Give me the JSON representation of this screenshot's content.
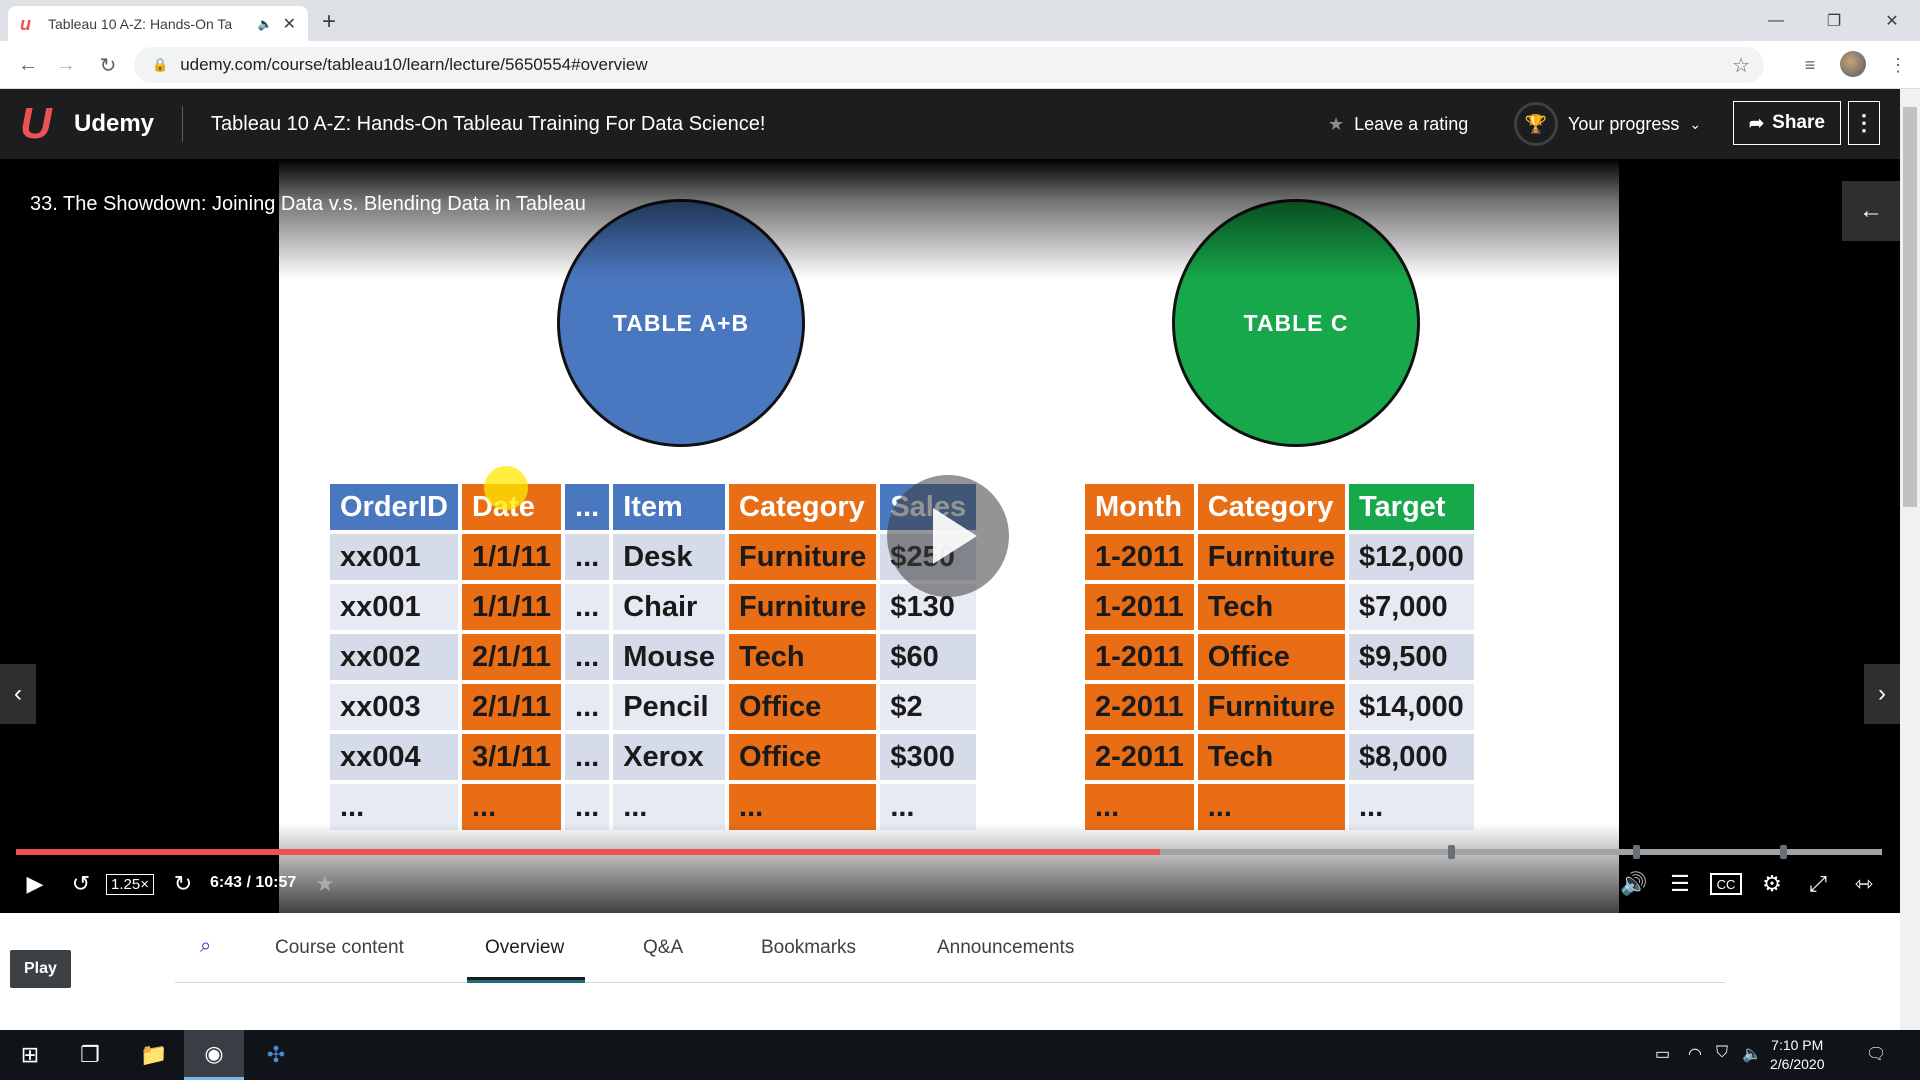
{
  "browser": {
    "tab_title": "Tableau 10 A-Z: Hands-On Ta",
    "url": "udemy.com/course/tableau10/learn/lecture/5650554#overview"
  },
  "header": {
    "brand": "Udemy",
    "course_title": "Tableau 10 A-Z: Hands-On Tableau Training For Data Science!",
    "rating_label": "Leave a rating",
    "progress_label": "Your progress",
    "share_label": "Share"
  },
  "video": {
    "lecture_title": "33. The Showdown: Joining Data v.s. Blending Data in Tableau",
    "play_tooltip": "Play",
    "speed": "1.25×",
    "time": "6:43 / 10:57",
    "progress_fraction": 0.613,
    "slide": {
      "circle_left": "TABLE A+B",
      "circle_right": "TABLE C",
      "table_ab": {
        "headers": [
          "OrderID",
          "Date",
          "...",
          "Item",
          "Category",
          "Sales"
        ],
        "rows": [
          [
            "xx001",
            "1/1/11",
            "...",
            "Desk",
            "Furniture",
            "$250"
          ],
          [
            "xx001",
            "1/1/11",
            "...",
            "Chair",
            "Furniture",
            "$130"
          ],
          [
            "xx002",
            "2/1/11",
            "...",
            "Mouse",
            "Tech",
            "$60"
          ],
          [
            "xx003",
            "2/1/11",
            "...",
            "Pencil",
            "Office",
            "$2"
          ],
          [
            "xx004",
            "3/1/11",
            "...",
            "Xerox",
            "Office",
            "$300"
          ],
          [
            "...",
            "...",
            "...",
            "...",
            "...",
            "..."
          ]
        ]
      },
      "table_c": {
        "headers": [
          "Month",
          "Category",
          "Target"
        ],
        "rows": [
          [
            "1-2011",
            "Furniture",
            "$12,000"
          ],
          [
            "1-2011",
            "Tech",
            "$7,000"
          ],
          [
            "1-2011",
            "Office",
            "$9,500"
          ],
          [
            "2-2011",
            "Furniture",
            "$14,000"
          ],
          [
            "2-2011",
            "Tech",
            "$8,000"
          ],
          [
            "...",
            "...",
            "..."
          ]
        ]
      }
    }
  },
  "course_tabs": [
    "Course content",
    "Overview",
    "Q&A",
    "Bookmarks",
    "Announcements"
  ],
  "active_tab": "Overview",
  "taskbar": {
    "time": "7:10 PM",
    "date": "2/6/2020"
  },
  "colors": {
    "accent": "#ec5252",
    "header_bg": "#1c1d1f",
    "table_blue": "#4a78c0",
    "table_orange": "#e86d15",
    "table_green": "#16a84a"
  }
}
